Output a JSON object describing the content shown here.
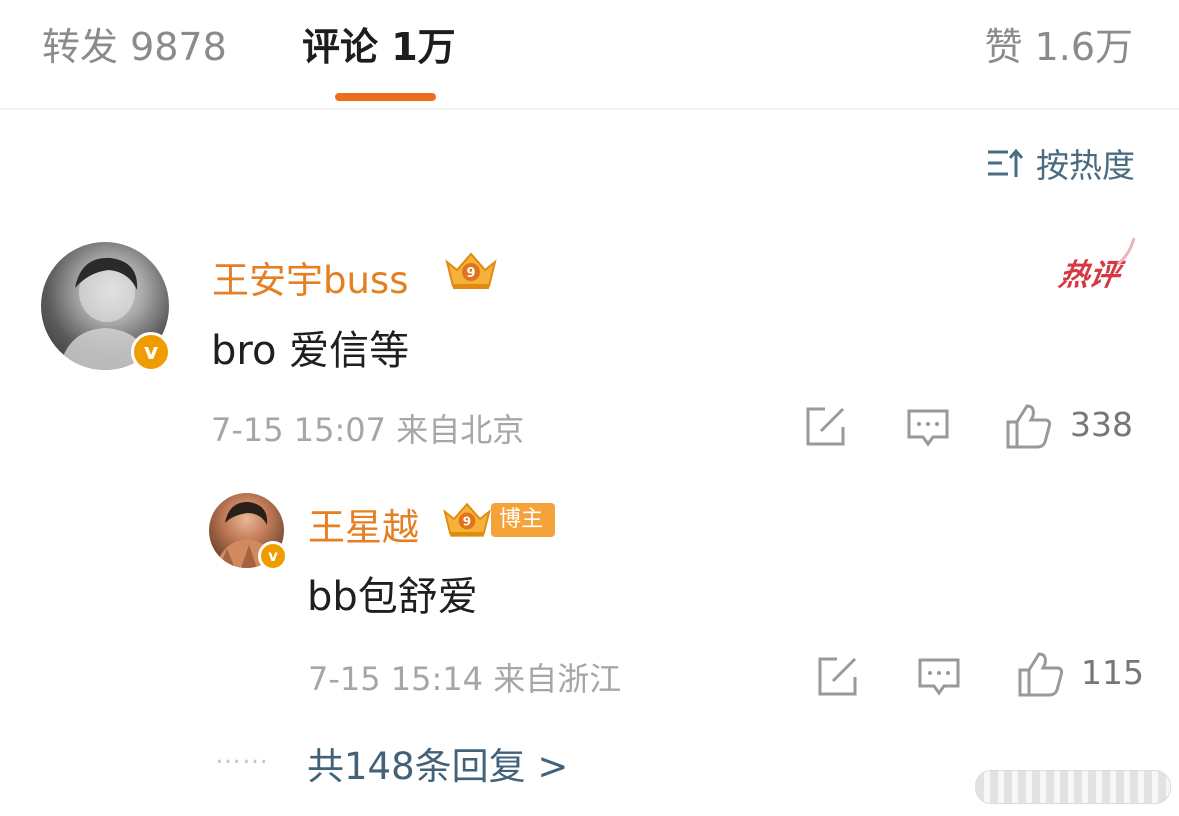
{
  "tabs": {
    "repost": "转发 9878",
    "comment": "评论 1万",
    "like": "赞 1.6万"
  },
  "sort": {
    "label": "按热度",
    "icon": "sort-icon"
  },
  "comment": {
    "username": "王安宇buss",
    "hot_badge": "热评",
    "text": "bro 爱信等",
    "meta": "7-15 15:07 来自北京",
    "like_count": "338",
    "verified_mark": "v"
  },
  "reply": {
    "username": "王星越",
    "tag": "博主",
    "text": "bb包舒爱",
    "meta": "7-15 15:14 来自浙江",
    "like_count": "115",
    "verified_mark": "v"
  },
  "thread": {
    "dots": "……",
    "link": "共148条回复 >"
  },
  "colors": {
    "accent": "#ee6d1c",
    "username": "#e57f21",
    "link": "#42627a",
    "hot": "#d33a44",
    "badge": "#ee9c00"
  }
}
